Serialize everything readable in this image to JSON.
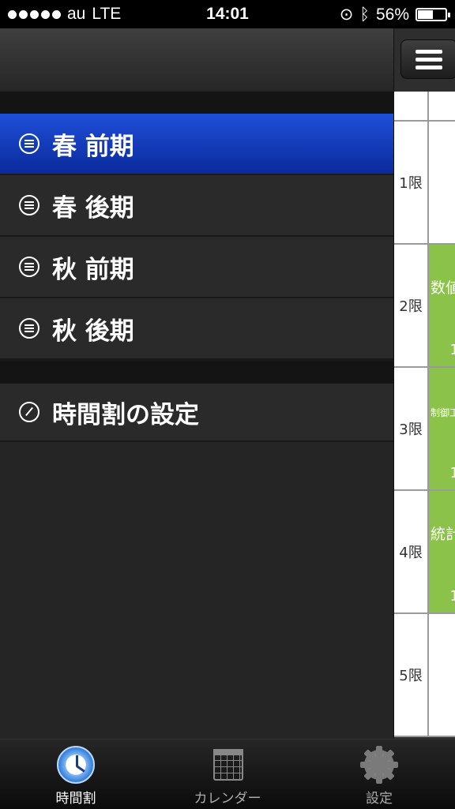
{
  "status": {
    "carrier": "au",
    "network": "LTE",
    "time": "14:01",
    "battery": "56%"
  },
  "menu": {
    "terms": [
      {
        "label": "春 前期",
        "active": true
      },
      {
        "label": "春 後期",
        "active": false
      },
      {
        "label": "秋 前期",
        "active": false
      },
      {
        "label": "秋 後期",
        "active": false
      }
    ],
    "settings_label": "時間割の設定"
  },
  "timetable": {
    "periods": [
      "1限",
      "2限",
      "3限",
      "4限",
      "5限"
    ],
    "cells": [
      {
        "subject": "",
        "room": ""
      },
      {
        "subject": "数値",
        "room": "1"
      },
      {
        "subject": "制御工",
        "room": "1"
      },
      {
        "subject": "統計",
        "room": "1"
      },
      {
        "subject": "",
        "room": ""
      }
    ]
  },
  "tabs": [
    {
      "label": "時間割",
      "icon": "clock-icon"
    },
    {
      "label": "カレンダー",
      "icon": "calendar-icon"
    },
    {
      "label": "設定",
      "icon": "gear-icon"
    }
  ],
  "colors": {
    "active_menu": "#0a2a9c",
    "course_cell": "#8bc34a"
  }
}
